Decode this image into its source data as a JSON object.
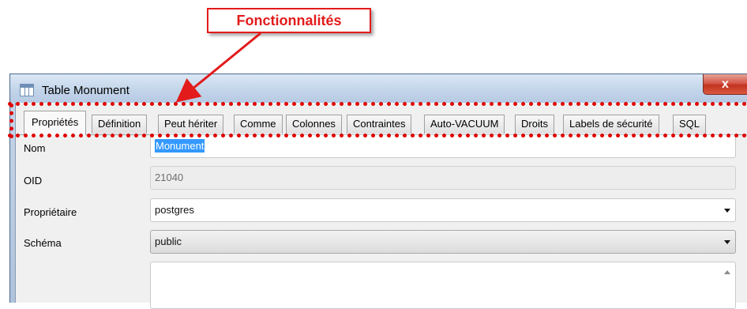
{
  "annotation": {
    "label": "Fonctionnalités",
    "color": "#e31b1b"
  },
  "window": {
    "title": "Table Monument",
    "icon": "table-icon",
    "close_label": "x"
  },
  "tabs": [
    {
      "label": "Propriétés",
      "active": true
    },
    {
      "label": "Définition",
      "active": false
    },
    {
      "label": "Peut hériter",
      "active": false
    },
    {
      "label": "Comme",
      "active": false
    },
    {
      "label": "Colonnes",
      "active": false
    },
    {
      "label": "Contraintes",
      "active": false
    },
    {
      "label": "Auto-VACUUM",
      "active": false
    },
    {
      "label": "Droits",
      "active": false
    },
    {
      "label": "Labels de sécurité",
      "active": false
    },
    {
      "label": "SQL",
      "active": false
    }
  ],
  "form": {
    "name_label": "Nom",
    "name_value": "Monument",
    "oid_label": "OID",
    "oid_value": "21040",
    "owner_label": "Propriétaire",
    "owner_value": "postgres",
    "schema_label": "Schéma",
    "schema_value": "public"
  }
}
